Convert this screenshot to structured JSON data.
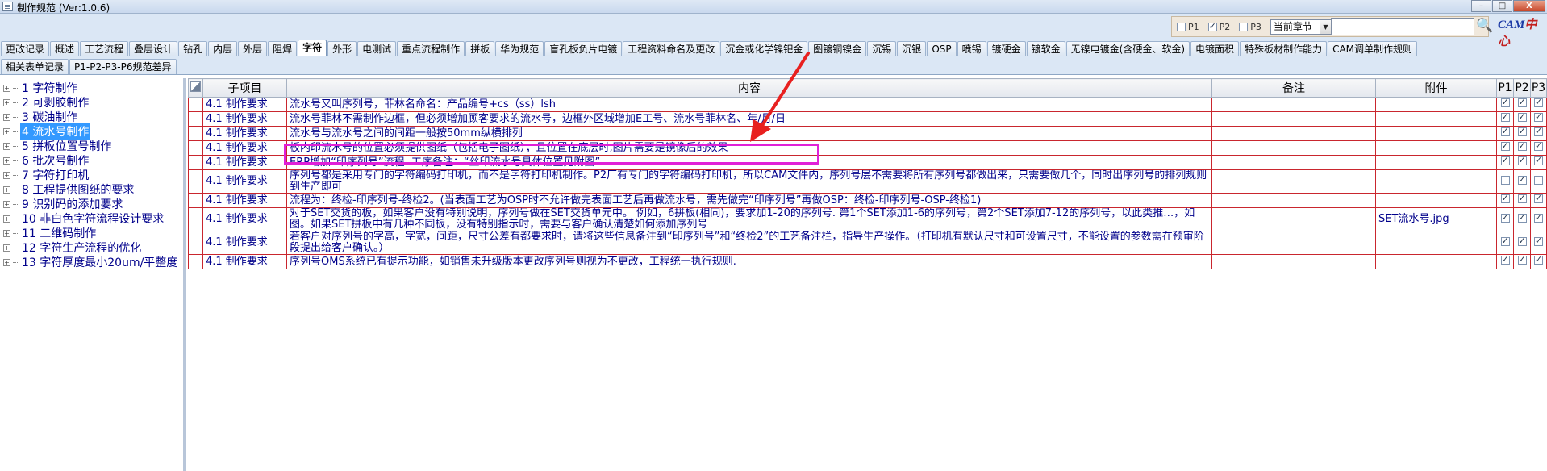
{
  "window": {
    "title": "制作规范 (Ver:1.0.6)",
    "min_label": "–",
    "max_label": "□",
    "close_label": "X"
  },
  "filter": {
    "p1_label": "P1",
    "p2_label": "P2",
    "p3_label": "P3",
    "p1_checked": false,
    "p2_checked": true,
    "p3_checked": false,
    "scope_value": "当前章节",
    "search_value": ""
  },
  "brand": {
    "text_a": "CAM",
    "text_b": "中心"
  },
  "tabs_row1": [
    "更改记录",
    "概述",
    "工艺流程",
    "叠层设计",
    "钻孔",
    "内层",
    "外层",
    "阻焊",
    "字符",
    "外形",
    "电测试",
    "重点流程制作",
    "拼板",
    "华为规范",
    "盲孔板负片电镀",
    "工程资料命名及更改",
    "沉金或化学镍钯金",
    "图镀铜镍金",
    "沉锡",
    "沉银",
    "OSP",
    "喷锡",
    "镀硬金",
    "镀软金",
    "无镍电镀金(含硬金、软金)",
    "电镀面积",
    "特殊板材制作能力",
    "CAM调单制作规则"
  ],
  "active_tab": "字符",
  "tabs_row2": [
    "相关表单记录",
    "P1-P2-P3-P6规范差异"
  ],
  "tree": [
    {
      "label": "1  字符制作"
    },
    {
      "label": "2  可剥胶制作"
    },
    {
      "label": "3  碳油制作"
    },
    {
      "label": "4  流水号制作",
      "selected": true
    },
    {
      "label": "5  拼板位置号制作"
    },
    {
      "label": "6  批次号制作"
    },
    {
      "label": "7  字符打印机"
    },
    {
      "label": "8  工程提供图纸的要求"
    },
    {
      "label": "9  识别码的添加要求"
    },
    {
      "label": "10  非白色字符流程设计要求"
    },
    {
      "label": "11  二维码制作"
    },
    {
      "label": "12  字符生产流程的优化"
    },
    {
      "label": "13  字符厚度最小20um/平整度"
    }
  ],
  "grid": {
    "headers": {
      "sub": "子项目",
      "content": "内容",
      "remark": "备注",
      "attachment": "附件",
      "p1": "P1",
      "p2": "P2",
      "p3": "P3"
    },
    "rows": [
      {
        "sub": "4.1 制作要求",
        "content": "流水号又叫序列号，菲林名命名：产品编号+cs（ss）lsh",
        "remark": "",
        "attachment": "",
        "p1": true,
        "p2": true,
        "p3": true
      },
      {
        "sub": "4.1 制作要求",
        "content": "流水号菲林不需制作边框，但必须增加顾客要求的流水号，边框外区域增加E工号、流水号菲林名、年/月/日",
        "remark": "",
        "attachment": "",
        "p1": true,
        "p2": true,
        "p3": true
      },
      {
        "sub": "4.1 制作要求",
        "content": "流水号与流水号之间的间距一般按50mm纵横排列",
        "remark": "",
        "attachment": "",
        "p1": true,
        "p2": true,
        "p3": true
      },
      {
        "sub": "4.1 制作要求",
        "content": "板内印流水号的位置必须提供图纸（包括电子图纸）；且位置在底层时,图片需要是镜像后的效果",
        "remark": "",
        "attachment": "",
        "p1": true,
        "p2": true,
        "p3": true
      },
      {
        "sub": "4.1 制作要求",
        "content": "ERP增加“印序列号”流程. 工序备注：“丝印流水号具体位置见附图”",
        "remark": "",
        "attachment": "",
        "p1": true,
        "p2": true,
        "p3": true
      },
      {
        "sub": "4.1 制作要求",
        "content": "序列号都是采用专门的字符编码打印机，而不是字符打印机制作。P2厂有专门的字符编码打印机，所以CAM文件内，序列号层不需要将所有序列号都做出来，只需要做几个，同时出序列号的排列规则到生产即可",
        "remark": "",
        "attachment": "",
        "p1": false,
        "p2": true,
        "p3": false
      },
      {
        "sub": "4.1 制作要求",
        "content": "流程为：终检-印序列号-终检2。(当表面工艺为OSP时不允许做完表面工艺后再做流水号，需先做完“印序列号”再做OSP：终检-印序列号-OSP-终检1)",
        "remark": "",
        "attachment": "",
        "p1": true,
        "p2": true,
        "p3": true
      },
      {
        "sub": "4.1 制作要求",
        "content": "对于SET交货的板，如果客户没有特别说明，序列号做在SET交货单元中。 例如，6拼板(相同)，要求加1-20的序列号. 第1个SET添加1-6的序列号，第2个SET添加7-12的序列号，以此类推…，如图。如果SET拼板中有几种不同板，没有特别指示时，需要与客户确认清楚如何添加序列号",
        "remark": "",
        "attachment": "SET流水号.jpg",
        "p1": true,
        "p2": true,
        "p3": true
      },
      {
        "sub": "4.1 制作要求",
        "content": "若客户对序列号的字高，字宽，间距，尺寸公差有都要求时，请将这些信息备注到“印序列号”和“终检2”的工艺备注栏，指导生产操作。（打印机有默认尺寸和可设置尺寸，不能设置的参数需在预审阶段提出给客户确认。）",
        "remark": "",
        "attachment": "",
        "p1": true,
        "p2": true,
        "p3": true
      },
      {
        "sub": "4.1 制作要求",
        "content": "序列号OMS系统已有提示功能，如销售未升级版本更改序列号则视为不更改，工程统一执行规则.",
        "remark": "",
        "attachment": "",
        "p1": true,
        "p2": true,
        "p3": true
      }
    ]
  }
}
